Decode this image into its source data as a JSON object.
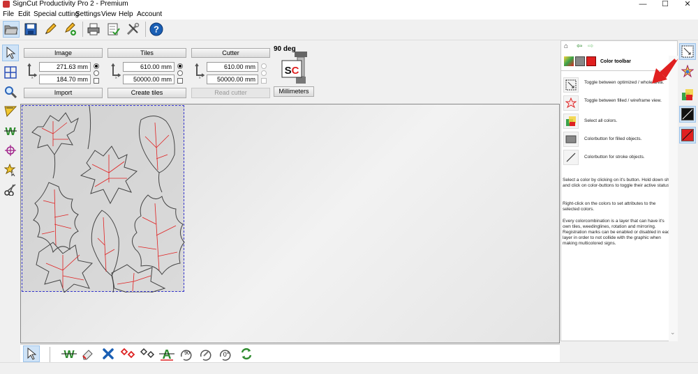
{
  "window": {
    "title": "SignCut Productivity Pro 2 - Premium",
    "minimize": "—",
    "maximize": "☐",
    "close": "✕"
  },
  "menu": [
    "File",
    "Edit",
    "Special cutting",
    "Settings",
    "View",
    "Help",
    "Account"
  ],
  "toolbar_icons": [
    "open-folder-icon",
    "save-icon",
    "edit-pen-icon",
    "add-edit-icon",
    "print-icon",
    "checklist-icon",
    "tools-icon",
    "help-icon"
  ],
  "left_tools": [
    "select-arrow-icon",
    "tiles-grid-icon",
    "zoom-icon",
    "weed-tool-icon",
    "weedline-w-icon",
    "crosshair-icon",
    "star-select-icon",
    "scissors-icon"
  ],
  "image": {
    "header": "Image",
    "width": "271.63 mm",
    "height": "184.70 mm",
    "action": "Import"
  },
  "tiles": {
    "header": "Tiles",
    "width": "610.00 mm",
    "height": "50000.00 mm",
    "action": "Create tiles"
  },
  "cutter": {
    "header": "Cutter",
    "width": "610.00 mm",
    "height": "50000.00 mm",
    "action": "Read cutter",
    "rotation": "90 deg",
    "units": "Millimeters"
  },
  "help_panel": {
    "title": "Color toolbar",
    "items": [
      {
        "icon": "optimize-toggle-icon",
        "text": "Toggle between optimized / whole area."
      },
      {
        "icon": "star-filled-wireframe-icon",
        "text": "Toggle between filled / wireframe view."
      },
      {
        "icon": "select-all-colors-icon",
        "text": "Select all colors."
      },
      {
        "icon": "filled-colorbutton-icon",
        "text": "Colorbutton for filled objects."
      },
      {
        "icon": "stroke-colorbutton-icon",
        "text": "Colorbutton for stroke objects."
      }
    ],
    "paragraphs": [
      "Select a color by clicking on it's button. Hold down shift and click on color-buttons to toggle their active status.",
      "Right-click on the colors to set attributes to the selected colors.",
      "Every colorcombination is a layer that can have it's own tiles, weedinglines, rotation and mirroring. Registration marks can be enabled or disabled in each layer in order to not collide with the graphic when making multicolored signs."
    ]
  },
  "bottom_tools": [
    "select-arrow-icon",
    "weedline-icon",
    "eraser-icon",
    "delete-x-icon",
    "registration-marks-icon",
    "registration-outline-icon",
    "text-weed-icon",
    "rotate-90-icon",
    "mirror-icon",
    "rotate-0-icon",
    "refresh-icon"
  ],
  "rotate_labels": {
    "r90": "90",
    "r0": "0°"
  },
  "colors": {
    "accent_red": "#e02020",
    "tile_border": "#3333cc",
    "highlight": "#cfe3f7",
    "help_blue": "#1a5fb4",
    "weed_green": "#2e8b2e"
  }
}
